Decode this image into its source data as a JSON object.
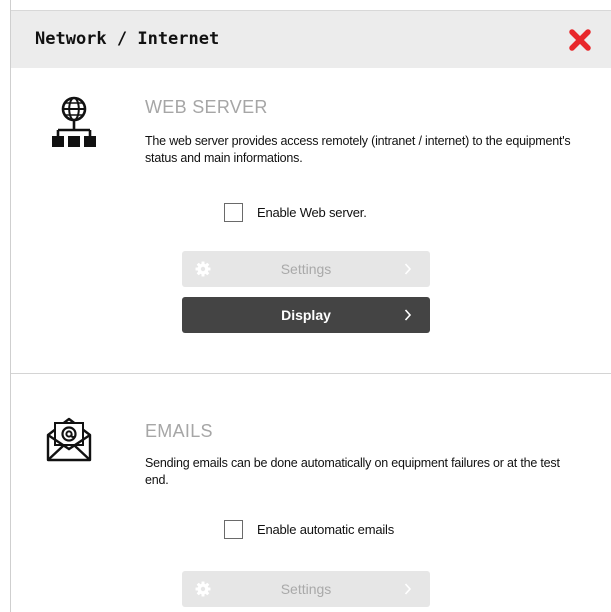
{
  "window": {
    "title": "Network / Internet",
    "close_icon": "close-icon",
    "close_color": "#e8282b"
  },
  "web_server": {
    "icon": "network-globe-icon",
    "heading": "WEB SERVER",
    "description": "The web server provides access remotely (intranet / internet) to the equipment's status and main informations.",
    "enable_label": "Enable Web server.",
    "enable_checked": false,
    "settings_label": "Settings",
    "settings_enabled": false,
    "display_label": "Display",
    "display_enabled": true
  },
  "emails": {
    "icon": "email-envelope-icon",
    "heading": "EMAILS",
    "description": "Sending emails can be done automatically on equipment failures or at the test end.",
    "enable_label": "Enable automatic emails",
    "enable_checked": false,
    "settings_label": "Settings",
    "settings_enabled": false
  },
  "colors": {
    "heading": "#a6a6a6",
    "button_dark": "#444444",
    "button_disabled": "#e6e6e6"
  }
}
